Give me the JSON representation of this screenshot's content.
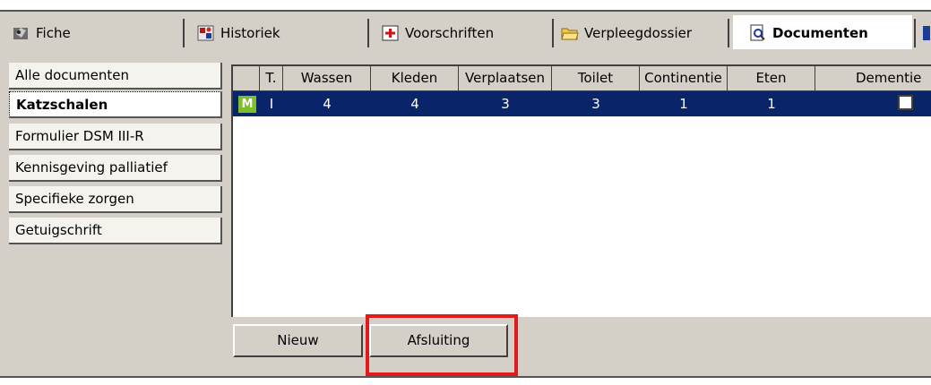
{
  "tabs": [
    {
      "label": "Fiche",
      "icon": "fiche-icon"
    },
    {
      "label": "Historiek",
      "icon": "historiek-icon"
    },
    {
      "label": "Voorschriften",
      "icon": "voorschriften-icon"
    },
    {
      "label": "Verpleegdossier",
      "icon": "folder-icon"
    },
    {
      "label": "Documenten",
      "icon": "magnifier-document-icon"
    }
  ],
  "sidebar": {
    "items": [
      {
        "label": "Alle documenten"
      },
      {
        "label": "Katzschalen"
      },
      {
        "label": "Formulier DSM III-R"
      },
      {
        "label": "Kennisgeving palliatief"
      },
      {
        "label": "Specifieke zorgen"
      },
      {
        "label": "Getuigschrift"
      }
    ]
  },
  "grid": {
    "columns": [
      "T.",
      "Wassen",
      "Kleden",
      "Verplaatsen",
      "Toilet",
      "Continentie",
      "Eten",
      "Dementie"
    ],
    "row": {
      "badge": "M",
      "type": "I",
      "wassen": "4",
      "kleden": "4",
      "verplaatsen": "3",
      "toilet": "3",
      "continentie": "1",
      "eten": "1",
      "dementie_checked": false
    }
  },
  "buttons": {
    "nieuw": "Nieuw",
    "afsluiting": "Afsluiting"
  },
  "colors": {
    "highlight": "#e11a1a",
    "selection": "#0a246a",
    "badge": "#7cbf28"
  }
}
